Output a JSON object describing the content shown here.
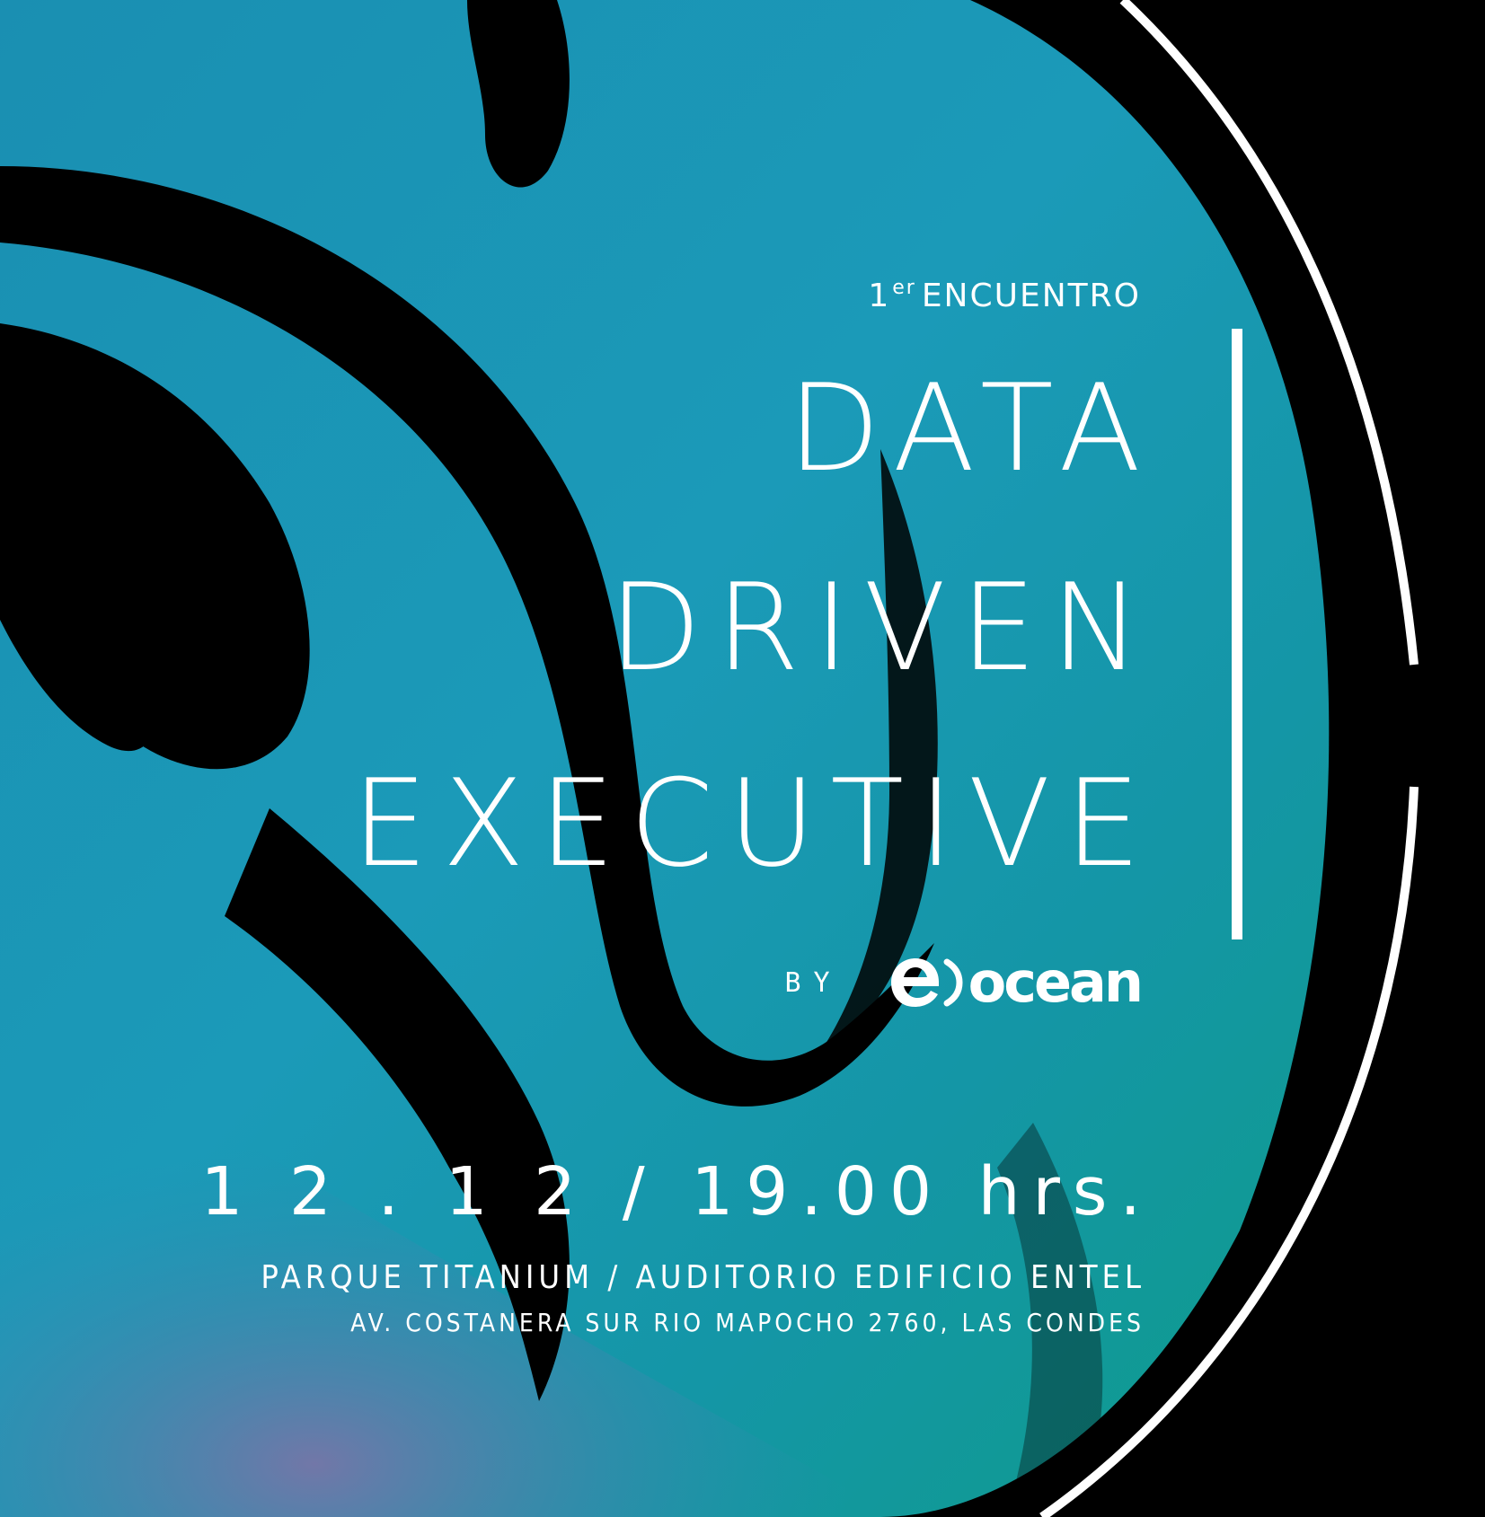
{
  "kicker": {
    "number": "1",
    "ordinal": "er",
    "label": "ENCUENTRO"
  },
  "title": {
    "line1": "DATA",
    "line2": "DRIVEN",
    "line3": "EXECUTIVE"
  },
  "byline": {
    "label": "BY",
    "brand": "ocean"
  },
  "event": {
    "date_time": "1 2 . 1 2 / 19.00 hrs.",
    "venue": "PARQUE TITANIUM / AUDITORIO EDIFICIO ENTEL",
    "address": "AV. COSTANERA SUR  RIO MAPOCHO 2760, LAS CONDES"
  },
  "colors": {
    "background": "#000000",
    "swirl_teal": "#1B9AB8",
    "swirl_green": "#0E9C8A",
    "swirl_lavender": "#6F79A8",
    "text": "#FFFFFF"
  }
}
